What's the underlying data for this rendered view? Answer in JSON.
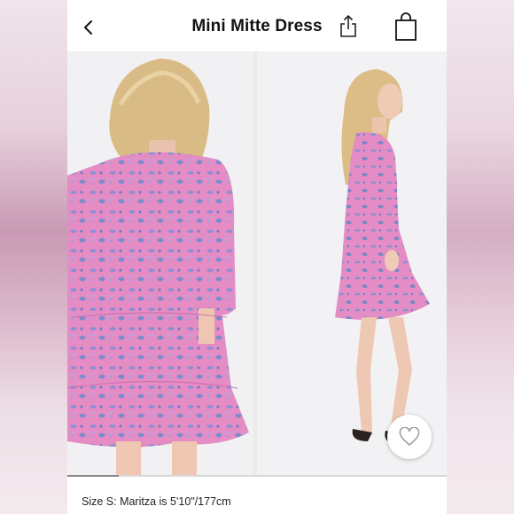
{
  "header": {
    "title": "Mini Mitte Dress",
    "back_icon": "chevron-left-icon",
    "share_icon": "share-icon",
    "bag_icon": "shopping-bag-icon"
  },
  "gallery": {
    "images": [
      "back-view",
      "side-view"
    ],
    "favorite_icon": "heart-icon"
  },
  "product": {
    "size_note": "Size S: Maritza is 5'10\"/177cm"
  },
  "colors": {
    "dress_pink": "#e58cc4",
    "print_blue": "#7f8fd0",
    "background": "#ffffff"
  }
}
